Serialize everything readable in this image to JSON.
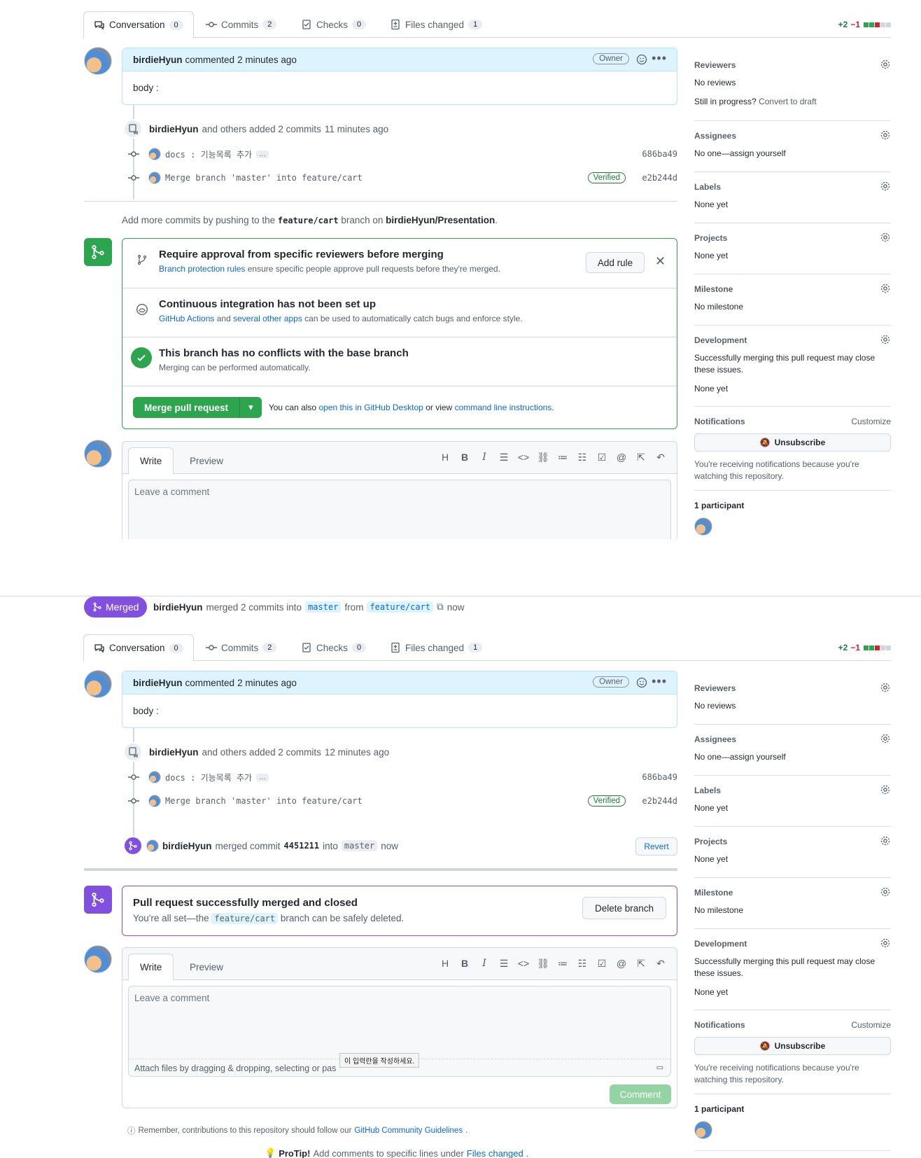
{
  "tabs": [
    {
      "label": "Conversation",
      "count": "0"
    },
    {
      "label": "Commits",
      "count": "2"
    },
    {
      "label": "Checks",
      "count": "0"
    },
    {
      "label": "Files changed",
      "count": "1"
    }
  ],
  "diffstat": {
    "add": "+2",
    "del": "−1"
  },
  "comment": {
    "author": "birdieHyun",
    "action": "commented",
    "time": "2 minutes ago",
    "badge": "Owner",
    "body": "body :"
  },
  "top": {
    "commits_header": {
      "author": "birdieHyun",
      "text": "and others added 2 commits",
      "time": "11 minutes ago"
    },
    "push_hint": {
      "prefix": "Add more commits by pushing to the",
      "branch": "feature/cart",
      "middle": "branch on",
      "repo": "birdieHyun/Presentation",
      "suffix": "."
    }
  },
  "commits": [
    {
      "msg": "docs : 기능목록 추가",
      "sha": "686ba49",
      "verified": ""
    },
    {
      "msg": "Merge branch 'master' into feature/cart",
      "sha": "e2b244d",
      "verified": "Verified"
    }
  ],
  "merge_box": {
    "review": {
      "title": "Require approval from specific reviewers before merging",
      "link": "Branch protection rules",
      "text": "ensure specific people approve pull requests before they're merged.",
      "button": "Add rule"
    },
    "ci": {
      "title": "Continuous integration has not been set up",
      "link1": "GitHub Actions",
      "and": "and",
      "link2": "several other apps",
      "text": "can be used to automatically catch bugs and enforce style."
    },
    "conflicts": {
      "title": "This branch has no conflicts with the base branch",
      "text": "Merging can be performed automatically."
    },
    "merge": {
      "button": "Merge pull request",
      "also": "You can also",
      "link1": "open this in GitHub Desktop",
      "or": "or view",
      "link2": "command line instructions",
      "end": "."
    }
  },
  "editor": {
    "write": "Write",
    "preview": "Preview",
    "placeholder": "Leave a comment"
  },
  "sidebar_top": {
    "reviewers": {
      "h": "Reviewers",
      "v": "No reviews",
      "v2": "Still in progress?",
      "link": "Convert to draft"
    },
    "assignees": {
      "h": "Assignees",
      "v": "No one—assign yourself"
    },
    "labels": {
      "h": "Labels",
      "v": "None yet"
    },
    "projects": {
      "h": "Projects",
      "v": "None yet"
    },
    "milestone": {
      "h": "Milestone",
      "v": "No milestone"
    },
    "development": {
      "h": "Development",
      "v": "Successfully merging this pull request may close these issues.",
      "v2": "None yet"
    },
    "notifications": {
      "h": "Notifications",
      "customize": "Customize",
      "button": "Unsubscribe",
      "v": "You're receiving notifications because you're watching this repository."
    },
    "participants": {
      "h": "1 participant"
    }
  },
  "bottom": {
    "merged_label": "Merged",
    "merged_line": {
      "author": "birdieHyun",
      "text": "merged 2 commits into",
      "base": "master",
      "from": "from",
      "head": "feature/cart",
      "time": "now"
    },
    "commits_header": {
      "author": "birdieHyun",
      "text": "and others added 2 commits",
      "time": "12 minutes ago"
    },
    "merge_event": {
      "author": "birdieHyun",
      "text": "merged commit",
      "sha": "4451211",
      "into": "into",
      "branch": "master",
      "time": "now",
      "revert": "Revert"
    },
    "closed": {
      "title": "Pull request successfully merged and closed",
      "prefix": "You're all set—the",
      "branch": "feature/cart",
      "suffix": "branch can be safely deleted.",
      "button": "Delete branch"
    },
    "attach": "Attach files by dragging & dropping, selecting or pas",
    "tooltip": "이 입력란을 작성하세요.",
    "comment_button": "Comment",
    "guidelines": {
      "text": "Remember, contributions to this repository should follow our",
      "link": "GitHub Community Guidelines",
      "end": "."
    },
    "protip": {
      "b": "ProTip!",
      "text": "Add comments to specific lines under",
      "link": "Files changed",
      "end": "."
    }
  }
}
